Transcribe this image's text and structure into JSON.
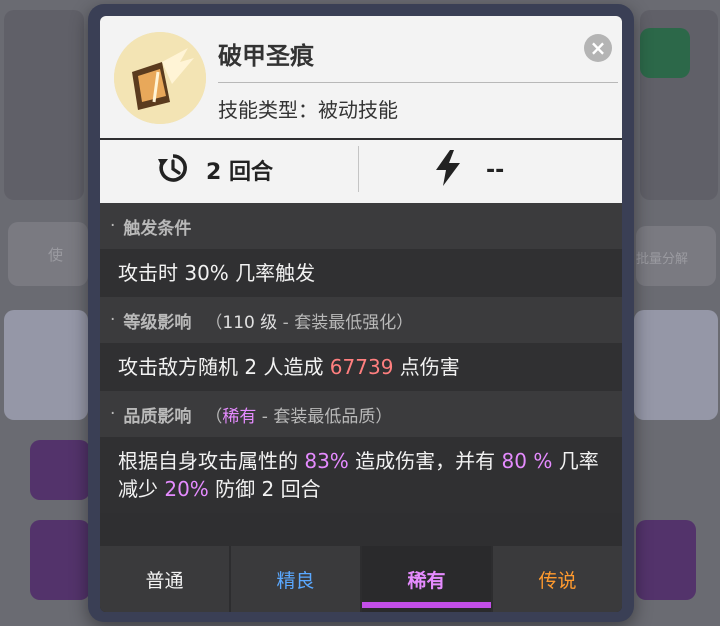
{
  "background": {
    "left_button_label": "使",
    "right_button_label": "批量分解"
  },
  "skill": {
    "name": "破甲圣痕",
    "type_label": "技能类型",
    "type_value": "被动技能"
  },
  "stats": {
    "cooldown": "2 回合",
    "energy": "--"
  },
  "sections": {
    "trigger": {
      "title": "触发条件",
      "body": {
        "pre": "攻击时 30% 几率触发"
      }
    },
    "level": {
      "title": "等级影响",
      "sub_open": "（",
      "sub_level": "110 级",
      "sub_note": " - 套装最低强化）",
      "body": {
        "pre": "攻击敌方随机 2 人造成 ",
        "damage": "67739",
        "post": " 点伤害"
      }
    },
    "quality": {
      "title": "品质影响",
      "sub_open": "（",
      "sub_rarity": "稀有",
      "sub_note": " - 套装最低品质）",
      "body": {
        "pre": "根据自身攻击属性的 ",
        "p1": "83%",
        "mid1": " 造成伤害，并有 ",
        "p2": "80 %",
        "mid2": " 几率减少 ",
        "p3": "20%",
        "post": " 防御 2 回合"
      }
    }
  },
  "tabs": [
    {
      "label": "普通",
      "color": "#f2f2f2"
    },
    {
      "label": "精良",
      "color": "#5aa8ff"
    },
    {
      "label": "稀有",
      "color": "#e58bff"
    },
    {
      "label": "传说",
      "color": "#ff9a2e"
    }
  ],
  "active_tab": "稀有",
  "icons": [
    "skill-emblem-icon",
    "close-icon",
    "cooldown-icon",
    "lightning-icon"
  ]
}
